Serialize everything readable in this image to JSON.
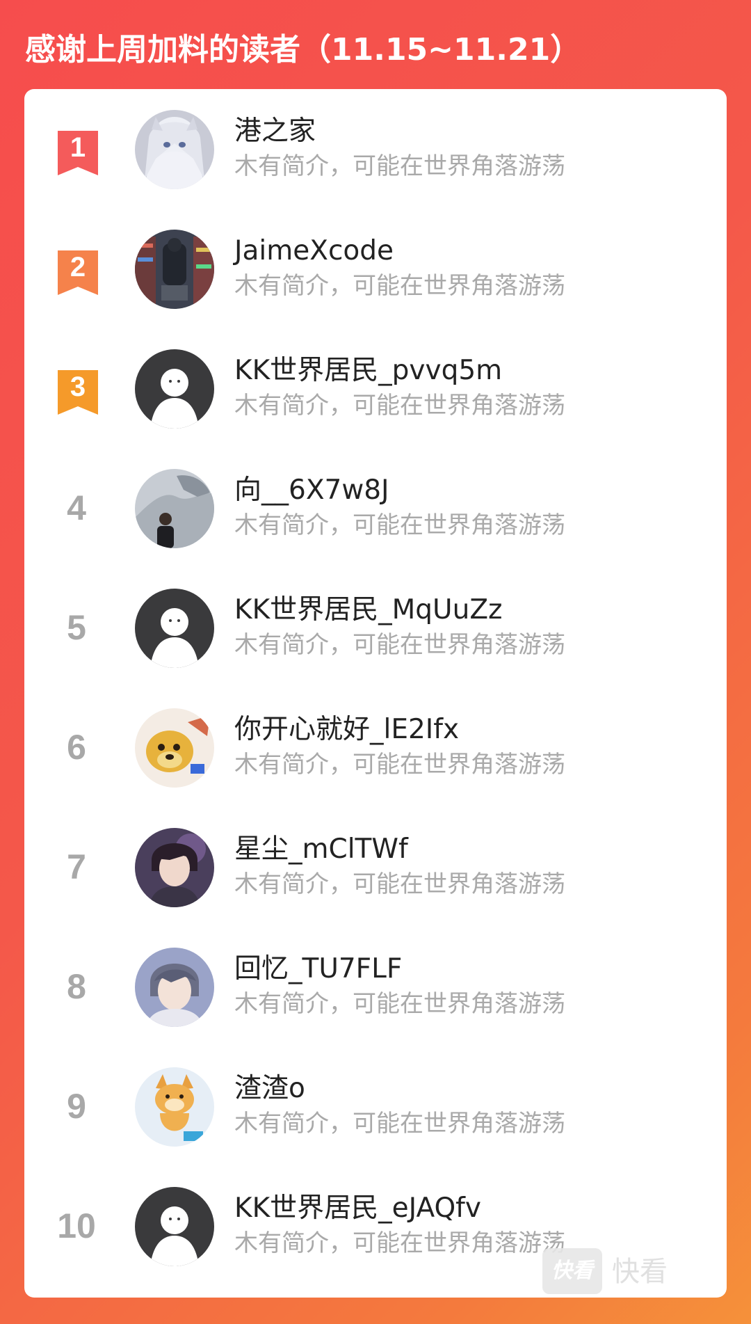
{
  "header": {
    "title": "感谢上周加料的读者（11.15~11.21）"
  },
  "colors": {
    "background_gradient_start": "#f64d4d",
    "background_gradient_end": "#f5913a",
    "rank1": "#f45b5b",
    "rank2": "#f5824b",
    "rank3": "#f59a2a",
    "rank_other": "#a8a8a8"
  },
  "readers": [
    {
      "rank": "1",
      "name": "港之家",
      "bio": "木有简介，可能在世界角落游荡",
      "avatar": "anime-girl-avatar"
    },
    {
      "rank": "2",
      "name": "JaimeXcode",
      "bio": "木有简介，可能在世界角落游荡",
      "avatar": "store-aisle-photo-avatar"
    },
    {
      "rank": "3",
      "name": "KK世界居民_pvvq5m",
      "bio": "木有简介，可能在世界角落游荡",
      "avatar": "default-user-avatar"
    },
    {
      "rank": "4",
      "name": "向__6X7w8J",
      "bio": "木有简介，可能在世界角落游荡",
      "avatar": "person-outdoor-photo-avatar"
    },
    {
      "rank": "5",
      "name": "KK世界居民_MqUuZz",
      "bio": "木有简介，可能在世界角落游荡",
      "avatar": "default-user-avatar"
    },
    {
      "rank": "6",
      "name": "你开心就好_lE2Ifx",
      "bio": "木有简介，可能在世界角落游荡",
      "avatar": "cartoon-dog-avatar"
    },
    {
      "rank": "7",
      "name": "星尘_mClTWf",
      "bio": "木有简介，可能在世界角落游荡",
      "avatar": "anime-boy-avatar"
    },
    {
      "rank": "8",
      "name": "回忆_TU7FLF",
      "bio": "木有简介，可能在世界角落游荡",
      "avatar": "anime-boy-avatar-2"
    },
    {
      "rank": "9",
      "name": "渣渣o",
      "bio": "木有简介，可能在世界角落游荡",
      "avatar": "shiba-dog-avatar"
    },
    {
      "rank": "10",
      "name": "KK世界居民_eJAQfv",
      "bio": "木有简介，可能在世界角落游荡",
      "avatar": "default-user-avatar"
    }
  ],
  "watermark": {
    "logo_text": "快看",
    "brand_text": "快看"
  }
}
